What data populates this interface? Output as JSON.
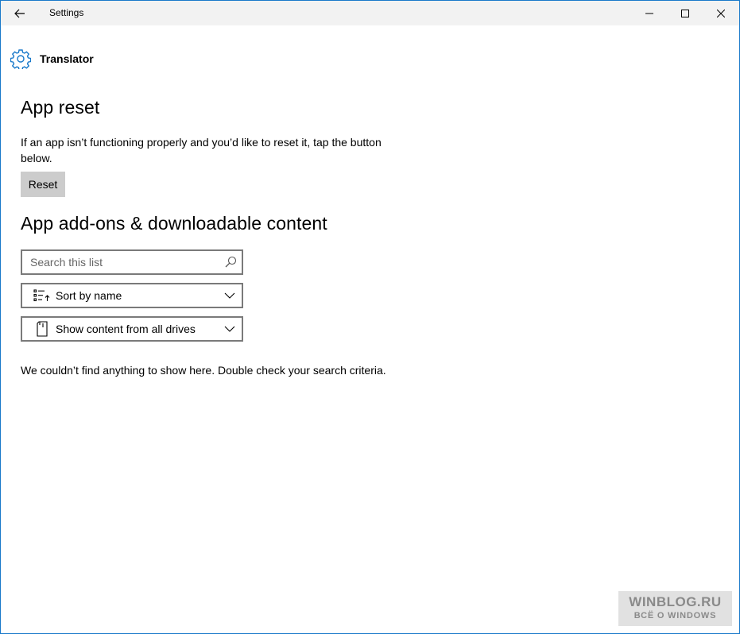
{
  "window": {
    "title": "Settings",
    "controls": {
      "minimize_icon": "minimize-icon",
      "maximize_icon": "maximize-icon",
      "close_icon": "close-icon"
    },
    "border_color": "#1979ca"
  },
  "header": {
    "icon": "gear-icon",
    "app_name": "Translator",
    "accent_color": "#1979ca"
  },
  "reset_section": {
    "title": "App reset",
    "description": "If an app isn’t functioning properly and you’d like to reset it, tap the button below.",
    "button_label": "Reset"
  },
  "addons_section": {
    "title": "App add-ons & downloadable content",
    "search": {
      "placeholder": "Search this list",
      "value": ""
    },
    "sort": {
      "selected": "Sort by name"
    },
    "drives": {
      "selected": "Show content from all drives"
    },
    "empty_message": "We couldn’t find anything to show here. Double check your search criteria."
  },
  "watermark": {
    "line1": "WINBLOG.RU",
    "line2": "ВСЁ О WINDOWS"
  }
}
